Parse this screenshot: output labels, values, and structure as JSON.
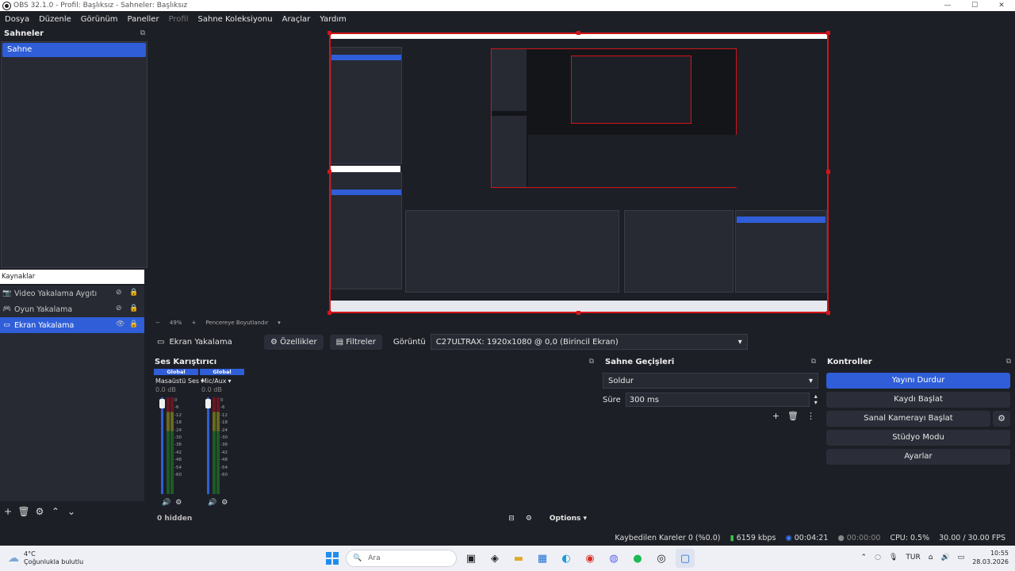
{
  "window": {
    "title": "OBS 32.1.0 - Profil: Başlıksız - Sahneler: Başlıksız",
    "minimize": "—",
    "maximize": "☐",
    "close": "✕"
  },
  "menu": [
    "Dosya",
    "Düzenle",
    "Görünüm",
    "Paneller",
    "Profil",
    "Sahne Koleksiyonu",
    "Araçlar",
    "Yardım"
  ],
  "scenes": {
    "title": "Sahneler",
    "items": [
      "Sahne"
    ]
  },
  "sources": {
    "title": "Kaynaklar",
    "items": [
      {
        "label": "Video Yakalama Aygıtı",
        "icon": "camera-icon"
      },
      {
        "label": "Oyun Yakalama",
        "icon": "gamepad-icon"
      },
      {
        "label": "Ekran Yakalama",
        "icon": "monitor-icon"
      }
    ]
  },
  "zoom": {
    "minus": "−",
    "value": "49%",
    "plus": "+",
    "fit": "Pencereye Boyutlandır"
  },
  "source_toolbar": {
    "name": "Ekran Yakalama",
    "properties": "Özellikler",
    "filters": "Filtreler",
    "display_label": "Görüntü",
    "display_value": "C27ULTRAX: 1920x1080 @ 0,0 (Birincil Ekran)"
  },
  "mixer": {
    "title": "Ses Karıştırıcı",
    "channels": [
      {
        "tag": "Global",
        "name": "Masaüstü Ses",
        "db": "0.0 dB"
      },
      {
        "tag": "Global",
        "name": "Mic/Aux",
        "db": "0.0 dB"
      }
    ],
    "scale": [
      "0",
      "-6",
      "-12",
      "-18",
      "-24",
      "-30",
      "-36",
      "-42",
      "-48",
      "-54",
      "-60"
    ],
    "hidden": "0 hidden",
    "options": "Options"
  },
  "transitions": {
    "title": "Sahne Geçişleri",
    "selected": "Soldur",
    "duration_label": "Süre",
    "duration": "300 ms"
  },
  "controls": {
    "title": "Kontroller",
    "stop_stream": "Yayını Durdur",
    "start_record": "Kaydı Başlat",
    "virtual_cam": "Sanal Kamerayı Başlat",
    "studio": "Stüdyo Modu",
    "settings": "Ayarlar"
  },
  "status": {
    "dropped": "Kaybedilen Kareler 0 (%0.0)",
    "bitrate": "6159 kbps",
    "stream_time": "00:04:21",
    "record_time": "00:00:00",
    "cpu": "CPU: 0.5%",
    "fps": "30.00 / 30.00 FPS"
  },
  "taskbar": {
    "temp": "4°C",
    "weather": "Çoğunlukla bulutlu",
    "search": "Ara",
    "lang": "TUR",
    "time": "10:55",
    "date": "28.03.2026"
  },
  "colors": {
    "accent": "#2f5ed8",
    "selection_border": "#d4141a",
    "bg": "#1d1f26",
    "panel": "#272a33"
  }
}
